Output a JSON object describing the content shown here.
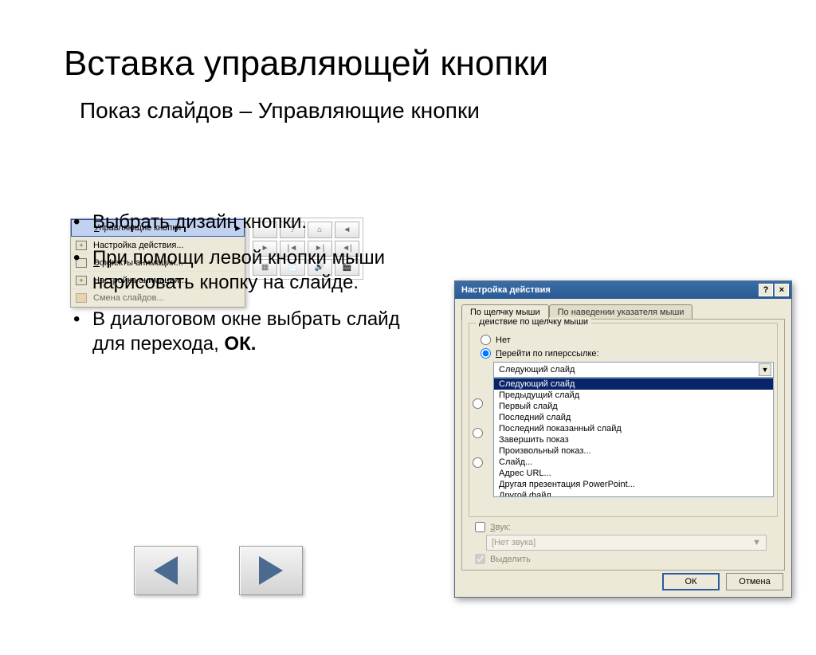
{
  "title": "Вставка управляющей кнопки",
  "subtitle": "Показ слайдов – Управляющие кнопки",
  "bullets": [
    "Выбрать дизайн кнопки.",
    "При помощи левой кнопки мыши нарисовать кнопку на слайде.",
    "В диалоговом окне выбрать слайд для перехода,  "
  ],
  "bullet3_bold": "ОК.",
  "menu": {
    "items": [
      {
        "label": "Управляющие кнопки",
        "selected": true,
        "arrow": true,
        "underline_letter": "У"
      },
      {
        "label": "Настройка действия...",
        "icon": "star"
      },
      {
        "label": "Эффекты анимации...",
        "icon": "sq",
        "underline_pos": true
      },
      {
        "label": "Настройка анимации...",
        "icon": "star"
      },
      {
        "label": "Смена слайдов...",
        "icon": "col"
      }
    ]
  },
  "action_button_symbols": [
    "",
    "?",
    "⌂",
    "◄",
    "►",
    "|◄",
    "►|",
    "◄|",
    "▦",
    "📄",
    "🔊",
    "🎬"
  ],
  "dialog": {
    "title": "Настройка действия",
    "help": "?",
    "close": "×",
    "tabs": [
      "По щелчку мыши",
      "По наведении указателя мыши"
    ],
    "group_legend": "Действие по щелчку мыши",
    "radio_none": "Нет",
    "radio_hyperlink": "Перейти по гиперссылке:",
    "combo_value": "Следующий слайд",
    "list": [
      "Следующий слайд",
      "Предыдущий слайд",
      "Первый слайд",
      "Последний слайд",
      "Последний показанный слайд",
      "Завершить показ",
      "Произвольный показ...",
      "Слайд...",
      "Адрес URL...",
      "Другая презентация PowerPoint...",
      "Другой файл..."
    ],
    "sound_label": "Звук:",
    "sound_value": "[Нет звука]",
    "highlight_label": "Выделить",
    "ok": "ОК",
    "cancel": "Отмена"
  }
}
